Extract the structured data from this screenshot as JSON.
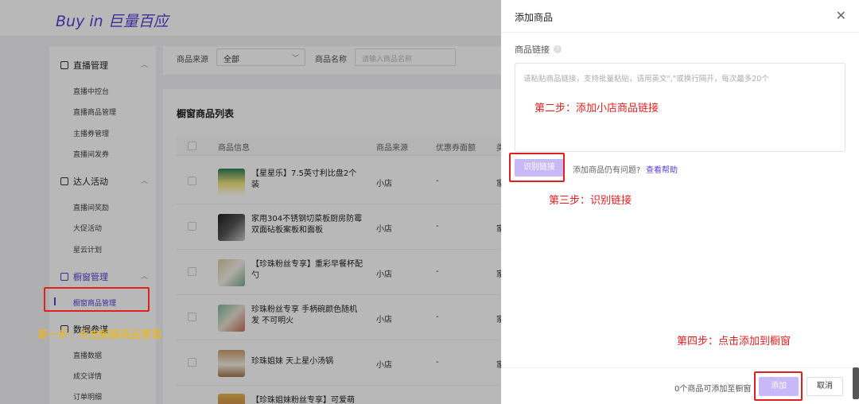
{
  "header": {
    "logo": "Buy in 巨量百应"
  },
  "sidebar": {
    "groups": [
      {
        "label": "直播管理",
        "items": [
          "直播中控台",
          "直播商品管理",
          "主播券管理",
          "直播间发券"
        ]
      },
      {
        "label": "达人活动",
        "items": [
          "直播间奖励",
          "大促活动",
          "星云计划"
        ]
      },
      {
        "label": "橱窗管理",
        "items": [
          "橱窗商品管理"
        ]
      },
      {
        "label": "数据参谋",
        "items": [
          "直播数据",
          "成交详情",
          "订单明细"
        ]
      }
    ]
  },
  "filters": {
    "source_label": "商品来源",
    "source_value": "全部",
    "name_label": "商品名称",
    "name_placeholder": "请输入商品名称"
  },
  "table": {
    "title": "橱窗商品列表",
    "columns": [
      "商品信息",
      "商品来源",
      "优惠券面额",
      "类"
    ],
    "rows": [
      {
        "name": "【星星乐】7.5英寸利比盘2个装",
        "source": "小店",
        "discount": "-",
        "cut": "家"
      },
      {
        "name": "家用304不锈钢切菜板厨房防霉双面砧板案板和面板",
        "source": "小店",
        "discount": "-",
        "cut": "家"
      },
      {
        "name": "【珍珠粉丝专享】重彩早餐杯配勺",
        "source": "小店",
        "discount": "-",
        "cut": "家"
      },
      {
        "name": "珍珠粉丝专享 手柄碗颜色随机发 不可明火",
        "source": "小店",
        "discount": "-",
        "cut": "家"
      },
      {
        "name": "珍珠姐妹 天上星小汤锅",
        "source": "小店",
        "discount": "-",
        "cut": "家"
      },
      {
        "name": "【珍珠姐妹粉丝专享】可爱萌",
        "source": "",
        "discount": "",
        "cut": ""
      }
    ]
  },
  "drawer": {
    "title": "添加商品",
    "field_label": "商品链接",
    "link_placeholder": "请粘贴商品链接，支持批量粘贴，请用英文\",\"或换行隔开，每次最多20个",
    "recognize_label": "识别链接",
    "help_text": "添加商品仍有问题?",
    "help_link": "查看帮助",
    "footer_count": "0个商品可添加至橱窗",
    "add_label": "添加",
    "cancel_label": "取消"
  },
  "annotations": {
    "step1": "第一步：点击橱窗商品管理",
    "step2": "第二步：添加小店商品链接",
    "step3": "第三步：识别链接",
    "step4": "第四步：点击添加到橱窗"
  },
  "colors": {
    "accent": "#5a3dd6",
    "annotation_red": "#e02020",
    "annotation_yellow": "#f5b800",
    "button_disabled": "#c9b8f7"
  }
}
